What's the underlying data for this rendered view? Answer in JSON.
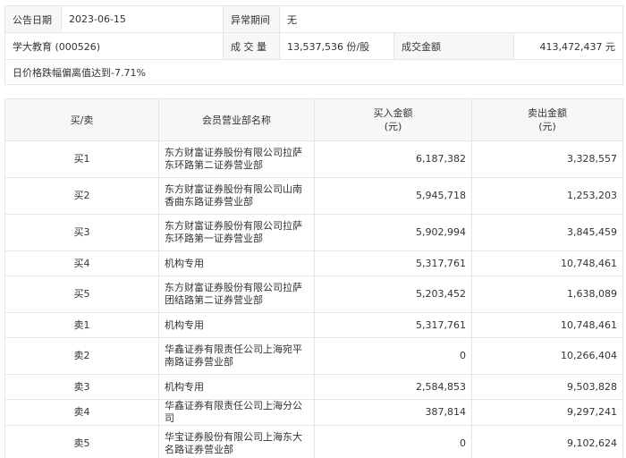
{
  "info": {
    "announce_label": "公告日期",
    "announce_value": "2023-06-15",
    "abnormal_label": "异常期间",
    "abnormal_value": "无",
    "stock_name": "学大教育 (000526)",
    "volume_label": "成 交 量",
    "volume_value": "13,537,536 份/股",
    "amount_label": "成交金额",
    "amount_value": "413,472,437 元",
    "reason": "日价格跌幅偏离值达到-7.71%"
  },
  "table": {
    "headers": {
      "side": "买/卖",
      "member": "会员营业部名称",
      "buy_line1": "买入金额",
      "buy_line2": "(元)",
      "sell_line1": "卖出金额",
      "sell_line2": "(元)"
    },
    "rows": [
      {
        "side": "买1",
        "member": "东方财富证券股份有限公司拉萨东环路第二证券营业部",
        "buy": "6,187,382",
        "sell": "3,328,557"
      },
      {
        "side": "买2",
        "member": "东方财富证券股份有限公司山南香曲东路证券营业部",
        "buy": "5,945,718",
        "sell": "1,253,203"
      },
      {
        "side": "买3",
        "member": "东方财富证券股份有限公司拉萨东环路第一证券营业部",
        "buy": "5,902,994",
        "sell": "3,845,459"
      },
      {
        "side": "买4",
        "member": "机构专用",
        "buy": "5,317,761",
        "sell": "10,748,461"
      },
      {
        "side": "买5",
        "member": "东方财富证券股份有限公司拉萨团结路第二证券营业部",
        "buy": "5,203,452",
        "sell": "1,638,089"
      },
      {
        "side": "卖1",
        "member": "机构专用",
        "buy": "5,317,761",
        "sell": "10,748,461"
      },
      {
        "side": "卖2",
        "member": "华鑫证券有限责任公司上海宛平南路证券营业部",
        "buy": "0",
        "sell": "10,266,404"
      },
      {
        "side": "卖3",
        "member": "机构专用",
        "buy": "2,584,853",
        "sell": "9,503,828"
      },
      {
        "side": "卖4",
        "member": "华鑫证券有限责任公司上海分公司",
        "buy": "387,814",
        "sell": "9,297,241"
      },
      {
        "side": "卖5",
        "member": "华宝证券股份有限公司上海东大名路证券营业部",
        "buy": "0",
        "sell": "9,102,624"
      }
    ]
  }
}
